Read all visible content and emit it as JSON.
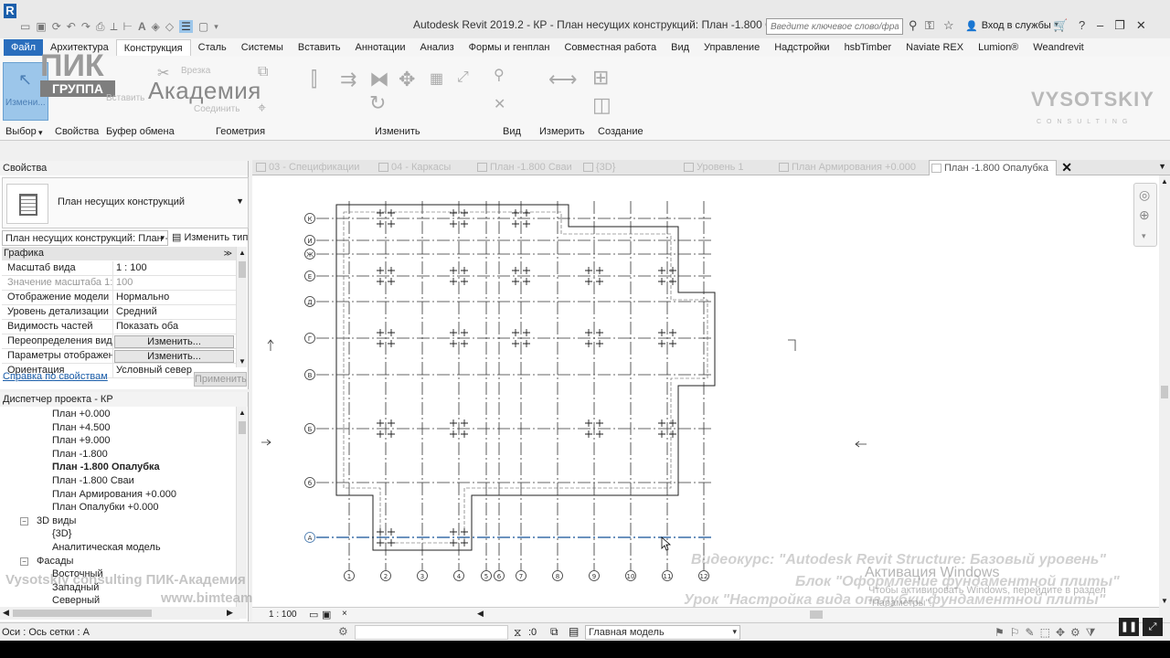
{
  "titlebar": {
    "title": "Autodesk Revit 2019.2 - КР - План несущих конструкций: План -1.800 Опалубка",
    "search_placeholder": "Введите ключевое слово/фразу",
    "login": "Вход в службы",
    "app_letter": "R"
  },
  "menu": {
    "tabs": [
      "Файл",
      "Архитектура",
      "Конструкция",
      "Сталь",
      "Системы",
      "Вставить",
      "Аннотации",
      "Анализ",
      "Формы и генплан",
      "Совместная работа",
      "Вид",
      "Управление",
      "Надстройки",
      "hsbTimber",
      "Naviate REX",
      "Lumion®",
      "Weandrevit"
    ]
  },
  "ribbon": {
    "groups": [
      "Выбор",
      "Свойства",
      "Буфер обмена",
      "Геометрия",
      "Изменить",
      "Вид",
      "Измерить",
      "Создание"
    ],
    "cut_label": "Врезка",
    "join_label": "Соединить",
    "insert_label": "Вставить",
    "modify_label": "Измени...",
    "academy": "Академия",
    "pik_top": "ПИК",
    "pik_band": "ГРУППА",
    "brand": "VYSOTSKIY",
    "brand_sub": "CONSULTING"
  },
  "properties": {
    "title": "Свойства",
    "type_name": "План несущих конструкций",
    "instance_selector": "План несущих конструкций: План -",
    "edit_type": "Изменить тип",
    "section": "Графика",
    "rows": [
      {
        "k": "Масштаб вида",
        "v": "1 : 100"
      },
      {
        "k": "Значение масштаба    1:",
        "v": "100"
      },
      {
        "k": "Отображение модели",
        "v": "Нормально"
      },
      {
        "k": "Уровень детализации",
        "v": "Средний"
      },
      {
        "k": "Видимость частей",
        "v": "Показать оба"
      },
      {
        "k": "Переопределения вид...",
        "v": "Изменить..."
      },
      {
        "k": "Параметры отображен...",
        "v": "Изменить..."
      },
      {
        "k": "Ориентация",
        "v": "Условный север"
      }
    ],
    "help_link": "Справка по свойствам",
    "apply": "Применить"
  },
  "browser": {
    "title": "Диспетчер проекта - КР",
    "items": [
      {
        "label": "План +0.000",
        "level": 2
      },
      {
        "label": "План +4.500",
        "level": 2
      },
      {
        "label": "План +9.000",
        "level": 2
      },
      {
        "label": "План -1.800",
        "level": 2
      },
      {
        "label": "План -1.800 Опалубка",
        "level": 2,
        "bold": true
      },
      {
        "label": "План -1.800 Сваи",
        "level": 2
      },
      {
        "label": "План Армирования +0.000",
        "level": 2
      },
      {
        "label": "План Опалубки +0.000",
        "level": 2
      },
      {
        "label": "3D виды",
        "level": 1,
        "toggle": "−"
      },
      {
        "label": "{3D}",
        "level": 2
      },
      {
        "label": "Аналитическая модель",
        "level": 2
      },
      {
        "label": "Фасады",
        "level": 1,
        "toggle": "−"
      },
      {
        "label": "Восточный",
        "level": 2
      },
      {
        "label": "Западный",
        "level": 2
      },
      {
        "label": "Северный",
        "level": 2
      }
    ]
  },
  "view_tabs": [
    {
      "label": "03 - Спецификации"
    },
    {
      "label": "04 - Каркасы"
    },
    {
      "label": "План -1.800 Сваи"
    },
    {
      "label": "{3D}"
    },
    {
      "label": "Уровень 1"
    },
    {
      "label": "План Армирования +0.000"
    },
    {
      "label": "План -1.800 Опалубка",
      "active": true
    }
  ],
  "grid": {
    "rows": [
      "К",
      "И",
      "Ж",
      "Е",
      "Д",
      "Г",
      "В",
      "Б",
      "б",
      "А"
    ],
    "cols": [
      "1",
      "2",
      "3",
      "4",
      "5",
      "6",
      "7",
      "8",
      "9",
      "10",
      "11",
      "12"
    ]
  },
  "watermarks": {
    "course1": "Видеокурс: \"Autodesk Revit Structure: Базовый уровень\"",
    "course2": "Блок \"Оформление фундаментной плиты\"",
    "course3": "Урок \"Настройка вида опалубки фундаментной плиты\"",
    "left1": "Vysotskiy consulting  ПИК-Академия",
    "left2": "www.bimteam.ru/academy",
    "activate_title": "Активация Windows",
    "activate_sub": "Чтобы активировать Windows, перейдите в раздел",
    "activate_sub2": "\"Параметры\"."
  },
  "viewctrl": {
    "scale": "1 : 100"
  },
  "status": {
    "left": "Оси : Ось сетки : А",
    "zero": ":0",
    "model": "Главная модель"
  },
  "colors": {
    "file_tab": "#2a6ebd",
    "selected_btn": "#9cc6ea",
    "link": "#1c5fab"
  }
}
